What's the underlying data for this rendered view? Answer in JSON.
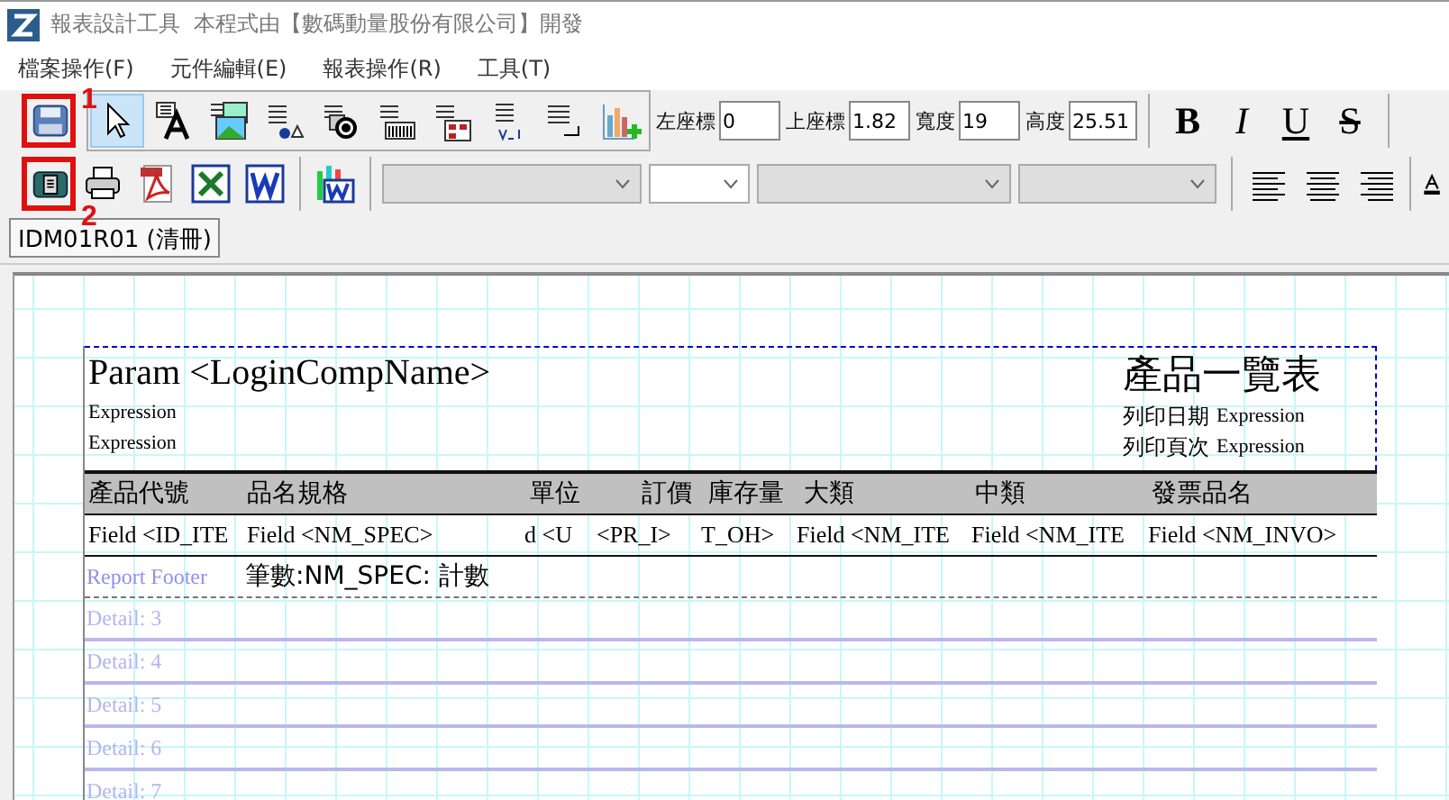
{
  "window": {
    "title": "報表設計工具  本程式由【數碼動量股份有限公司】開發"
  },
  "menu": [
    {
      "label": "檔案操作(F)"
    },
    {
      "label": "元件編輯(E)"
    },
    {
      "label": "報表操作(R)"
    },
    {
      "label": "工具(T)"
    }
  ],
  "toolbar_1": {
    "file_buttons": [
      {
        "kind": "save",
        "highlighted": true,
        "annotation": "1"
      }
    ],
    "tools": [
      {
        "kind": "pointer",
        "selected": true
      },
      {
        "kind": "text",
        "selected": false
      },
      {
        "kind": "image",
        "selected": false
      },
      {
        "kind": "shape",
        "selected": false
      },
      {
        "kind": "circle",
        "selected": false
      },
      {
        "kind": "barcode",
        "selected": false
      },
      {
        "kind": "qrcode",
        "selected": false
      },
      {
        "kind": "variable",
        "selected": false
      },
      {
        "kind": "line",
        "selected": false
      },
      {
        "kind": "chart",
        "selected": false
      }
    ],
    "position_fields": [
      {
        "label": "左座標",
        "value": "0"
      },
      {
        "label": "上座標",
        "value": "1.82"
      },
      {
        "label": "寬度",
        "value": "19"
      },
      {
        "label": "高度",
        "value": "25.51"
      }
    ],
    "font_style_buttons": [
      {
        "label": "B",
        "kind": "bold"
      },
      {
        "label": "I",
        "kind": "italic"
      },
      {
        "label": "U",
        "kind": "underline"
      },
      {
        "label": "S",
        "kind": "strike"
      }
    ]
  },
  "toolbar_2": {
    "output_buttons": [
      {
        "kind": "preview",
        "highlighted": true,
        "annotation": "2"
      },
      {
        "kind": "print",
        "highlighted": false
      },
      {
        "kind": "pdf",
        "highlighted": false
      },
      {
        "kind": "excel",
        "highlighted": false
      },
      {
        "kind": "word",
        "highlighted": false
      },
      {
        "kind": "chart-word",
        "highlighted": false
      }
    ],
    "dropdowns": [
      {
        "disabled": true
      },
      {
        "disabled": false
      },
      {
        "disabled": true
      },
      {
        "disabled": true
      }
    ],
    "align_buttons": [
      {
        "kind": "left"
      },
      {
        "kind": "center"
      },
      {
        "kind": "right"
      }
    ],
    "color_button": {
      "kind": "font-color"
    }
  },
  "tabs": [
    {
      "label": "IDM01R01 (清冊)",
      "selected": true
    }
  ],
  "report": {
    "header_left": {
      "title": "Param <LoginCompName>",
      "lines": [
        "Expression",
        "Expression"
      ]
    },
    "header_right": {
      "title": "產品一覽表",
      "rows": [
        {
          "label": "列印日期",
          "value": "Expression"
        },
        {
          "label": "列印頁次",
          "value": "Expression"
        }
      ]
    },
    "columns": [
      "產品代號",
      "品名規格",
      "單位",
      "訂價",
      "庫存量",
      "大類",
      "中類",
      "發票品名"
    ],
    "fields": [
      "Field <ID_ITE",
      "Field <NM_SPEC>",
      "d <U",
      "<PR_I>",
      "T_OH>",
      "Field <NM_ITE",
      "Field <NM_ITE",
      "Field <NM_INVO>"
    ],
    "footer": {
      "band_label": "Report Footer",
      "text": "筆數:NM_SPEC: 計數"
    },
    "detail_bands": [
      "Detail: 3",
      "Detail: 4",
      "Detail: 5",
      "Detail: 6",
      "Detail: 7"
    ]
  }
}
